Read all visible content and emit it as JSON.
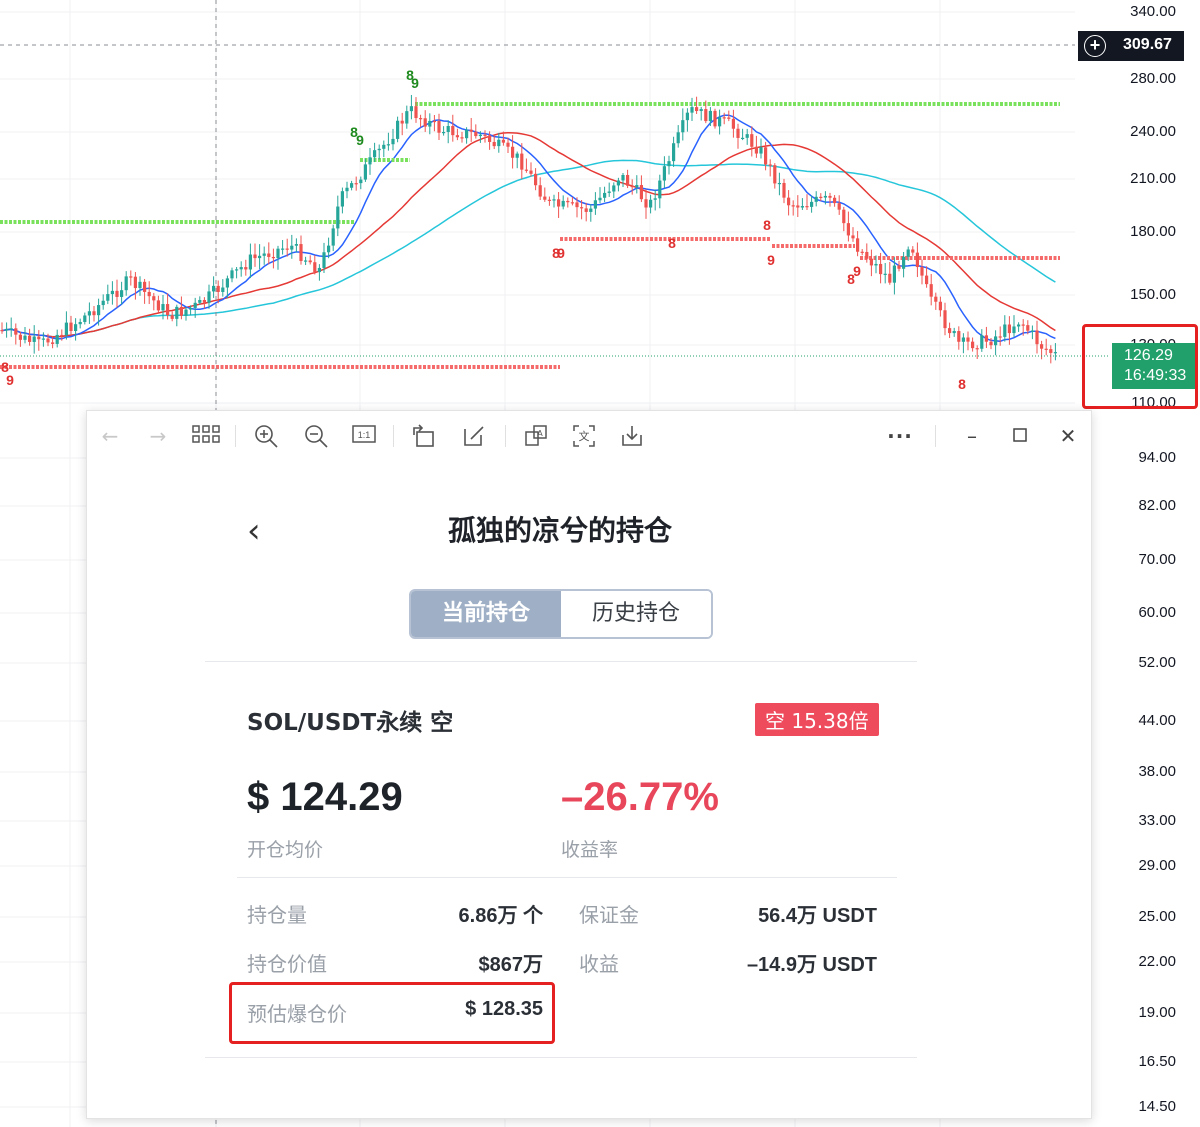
{
  "chart": {
    "price_axis": [
      "340.00",
      "280.00",
      "240.00",
      "210.00",
      "180.00",
      "150.00",
      "130.00",
      "110.00",
      "94.00",
      "82.00",
      "70.00",
      "60.00",
      "52.00",
      "44.00",
      "38.00",
      "33.00",
      "29.00",
      "25.00",
      "22.00",
      "19.00",
      "16.50",
      "14.50"
    ],
    "crosshair_price": "309.67",
    "crosshair_icon": "plus-circle-icon",
    "current_price": "126.29",
    "countdown": "16:49:33",
    "td_markers": [
      "8",
      "9",
      "8",
      "9",
      "8",
      "9",
      "8",
      "9",
      "8",
      "9",
      "8",
      "9",
      "8",
      "8"
    ],
    "colors": {
      "up": "#26a69a",
      "down": "#ef5350",
      "ma_fast": "#2962ff",
      "ma_mid": "#e53935",
      "ma_slow": "#26c6da",
      "resistance": "#7ae15c",
      "support": "#f56b6b",
      "highlight": "#e52020"
    }
  },
  "viewer": {
    "toolbar_icons": [
      "arrow-left-icon",
      "arrow-right-icon",
      "grid-icon",
      "zoom-in-icon",
      "zoom-out-icon",
      "actual-size-icon",
      "rotate-icon",
      "edit-icon",
      "translate-icon",
      "ocr-icon",
      "download-icon",
      "more-icon",
      "minimize-icon",
      "maximize-icon",
      "close-icon"
    ],
    "title": "孤独的凉兮的持仓",
    "tabs": [
      "当前持仓",
      "历史持仓"
    ],
    "position": {
      "contract": "SOL/USDT永续 空",
      "leverage_badge": "空 15.38倍",
      "entry_price": "$ 124.29",
      "entry_label": "开仓均价",
      "roi": "–26.77%",
      "roi_label": "收益率",
      "rows": [
        {
          "label": "持仓量",
          "value": "6.86万 个",
          "label2": "保证金",
          "value2": "56.4万 USDT"
        },
        {
          "label": "持仓价值",
          "value": "$867万",
          "label2": "收益",
          "value2": "–14.9万 USDT"
        },
        {
          "label": "预估爆仓价",
          "value": "$ 128.35"
        }
      ]
    }
  }
}
